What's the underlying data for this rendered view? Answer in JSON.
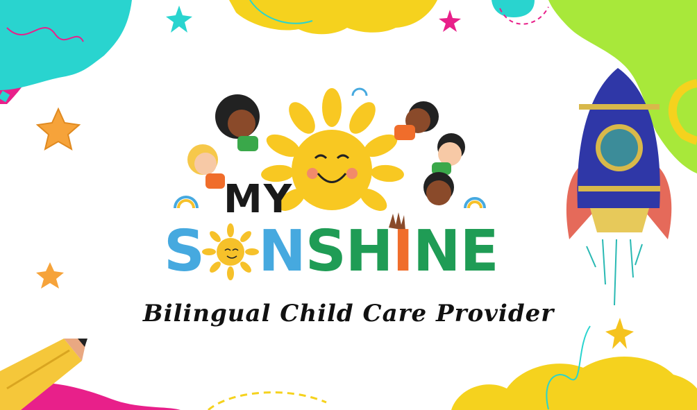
{
  "logo": {
    "line1": "MY",
    "line2_letters": [
      "S",
      "O",
      "N",
      "S",
      "H",
      "I",
      "N",
      "E"
    ],
    "line2_colors": [
      "#46a9df",
      "#f6c12a",
      "#46a9df",
      "#1f9c55",
      "#1f9c55",
      "#f06d2b",
      "#1f9c55",
      "#1f9c55"
    ],
    "line2_text": "SONSHINE"
  },
  "subtitle": "Bilingual Child Care Provider",
  "colors": {
    "sun": "#f8c822",
    "cyan_blob": "#29d4cf",
    "green_blob": "#a8e83a",
    "yellow_blob": "#f5d21e",
    "magenta": "#e8208a",
    "rocket_body": "#2f37a7",
    "rocket_fin": "#e56a5a",
    "rocket_window": "#3c8c99",
    "star_orange": "#f6a33a"
  },
  "icons": [
    "sun-icon",
    "rocket-icon",
    "pencil-icon",
    "star-icon",
    "rainbow-icon",
    "child-icon"
  ]
}
